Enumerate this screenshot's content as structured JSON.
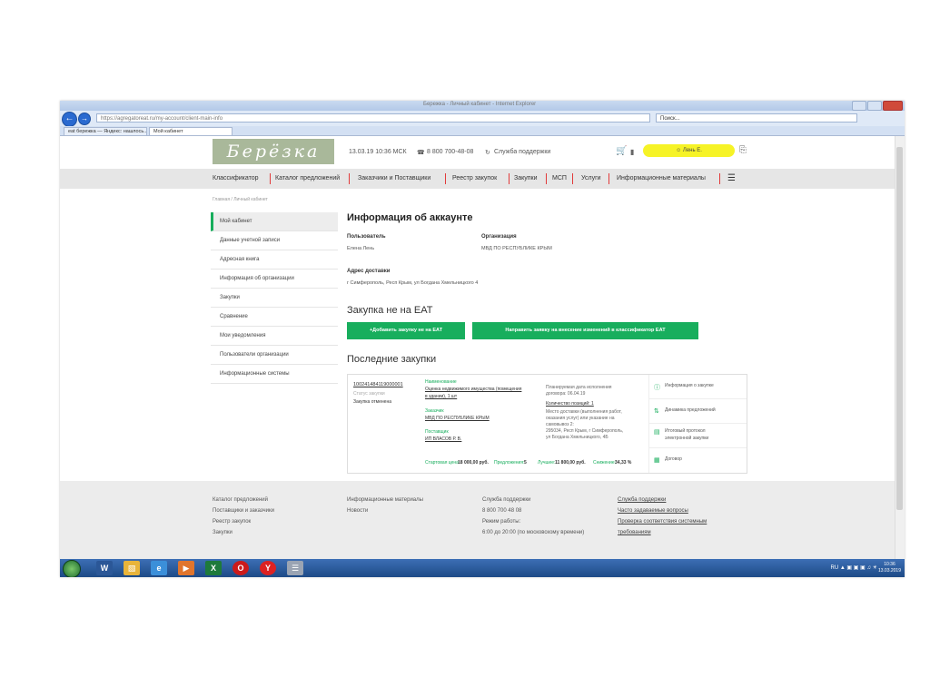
{
  "browser": {
    "window_title": "Бережка - Личный кабинет - Internet Explorer",
    "address": "https://agregatoreat.ru/my-account/client-main-info",
    "search_placeholder": "Поиск...",
    "tabs": [
      {
        "label": "eat бережка — Яндекс: нашлось..."
      },
      {
        "label": "Мой кабинет"
      }
    ]
  },
  "header": {
    "logo_text": "Берёзка",
    "datetime": "13.03.19 10:36 МСК",
    "phone": "8 800 700-48-08",
    "support": "Служба поддержки",
    "user_name": "Лень Е."
  },
  "menu": [
    {
      "label": "Классификатор"
    },
    {
      "label": "Каталог предложений"
    },
    {
      "label": "Заказчики и Поставщики"
    },
    {
      "label": "Реестр закупок"
    },
    {
      "label": "Закупки"
    },
    {
      "label": "МСП"
    },
    {
      "label": "Услуги"
    },
    {
      "label": "Информационные материалы"
    }
  ],
  "breadcrumb": "Главная / Личный кабинет",
  "sidebar": [
    {
      "label": "Мой кабинет"
    },
    {
      "label": "Данные учетной записи"
    },
    {
      "label": "Адресная книга"
    },
    {
      "label": "Информация об организации"
    },
    {
      "label": "Закупки"
    },
    {
      "label": "Сравнение"
    },
    {
      "label": "Мои уведомления"
    },
    {
      "label": "Пользователи организации"
    },
    {
      "label": "Информационные системы"
    }
  ],
  "account": {
    "title": "Информация об аккаунте",
    "user_label": "Пользователь",
    "user_value": "Елена Лень",
    "org_label": "Организация",
    "org_value": "МВД ПО РЕСПУБЛИКЕ КРЫМ",
    "address_label": "Адрес доставки",
    "address_value": "г Симферополь, Респ Крым, ул Богдана Хмельницкого 4"
  },
  "not_on_eat": {
    "title": "Закупка не на ЕАТ",
    "add_button": "+Добавить закупку не на ЕАТ",
    "classifier_button": "Направить заявку на внесение изменений в классификатор ЕАТ"
  },
  "recent": {
    "title": "Последние закупки",
    "purchase": {
      "number": "100241484119000001",
      "status_label": "Статус закупки",
      "status_value": "Закупка отменена",
      "name_label": "Наименование",
      "name_line1": "Оценка недвижимого имущества (помещения",
      "name_line2": "в здании), 1 шт",
      "customer_label": "Заказчик",
      "customer_value": "МВД ПО РЕСПУБЛИКЕ КРЫМ",
      "supplier_label": "Поставщик",
      "supplier_value": "ИП ВЛАСОВ Р. В.",
      "plan_date_line1": "Планируемая дата исполнения",
      "plan_date_line2": "договора: 06.04.19",
      "positions": "Количество позиций: 1",
      "delivery_line1": "Место доставки (выполнения работ,",
      "delivery_line2": "оказания услуг) или указание на",
      "delivery_line3": "самовывоз 2:",
      "delivery_line4": "295034, Респ Крым, г Симферополь,",
      "delivery_line5": "ул Богдана Хмельницкого, 4Б",
      "start_price_label": "Стартовая цена:",
      "start_price_value": "18 000,00 руб.",
      "offers_label": "Предложения:",
      "offers_value": "5",
      "best_label": "Лучшее:",
      "best_value": "11 800,00 руб.",
      "saving_label": "Снижение:",
      "saving_value": "34,33 %"
    },
    "actions": [
      {
        "label": "Информация о закупке"
      },
      {
        "label": "Динамика предложений"
      },
      {
        "label": "Итоговый протокол",
        "label2": "электронной закупки"
      },
      {
        "label": "Договор"
      }
    ]
  },
  "footer": {
    "col1": [
      {
        "label": "Каталог предложений"
      },
      {
        "label": "Поставщики и заказчики"
      },
      {
        "label": "Реестр закупок"
      },
      {
        "label": "Закупки"
      }
    ],
    "col2": [
      {
        "label": "Информационные материалы"
      },
      {
        "label": "Новости"
      }
    ],
    "col3": [
      {
        "label": "Служба поддержки"
      },
      {
        "label": "8 800 700 48 08"
      },
      {
        "label": "Режим работы:"
      },
      {
        "label": "6:00 до 20:00 (по московскому времени)"
      }
    ],
    "col4": [
      {
        "label": "Служба поддержки"
      },
      {
        "label": "Часто задаваемые вопросы"
      },
      {
        "label": "Проверка соответствия системным"
      },
      {
        "label": "требованиям"
      }
    ]
  },
  "taskbar": {
    "lang": "RU",
    "time": "10:36",
    "date": "13.03.2019"
  },
  "colors": {
    "accent_green": "#18ae5d",
    "user_yellow": "#f6f327",
    "menu_separator": "#e23a3a"
  }
}
